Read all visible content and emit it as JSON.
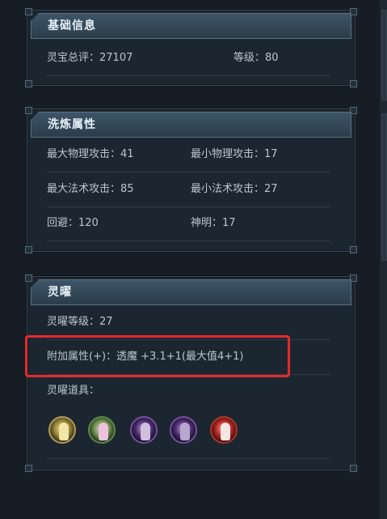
{
  "basic_info": {
    "title": "基础信息",
    "rating_label": "灵宝总评：27107",
    "level_label": "等级：80"
  },
  "refine": {
    "title": "洗炼属性",
    "max_phys": "最大物理攻击：41",
    "min_phys": "最小物理攻击：17",
    "max_magic": "最大法术攻击：85",
    "min_magic": "最小法术攻击：27",
    "dodge": "回避：120",
    "spirit": "神明：17"
  },
  "lingyao": {
    "title": "灵曜",
    "level": "灵曜等级：27",
    "bonus": "附加属性(+)：透魔 +3.1+1(最大值4+1)",
    "items_label": "灵曜道具：",
    "items": [
      {
        "icon": "golden-spirit-icon"
      },
      {
        "icon": "pink-spirit-icon"
      },
      {
        "icon": "purple-warrior-icon"
      },
      {
        "icon": "purple-mage-icon"
      },
      {
        "icon": "red-spirit-icon"
      }
    ]
  },
  "colors": {
    "highlight": "#e52b2b",
    "header": "#3d5567"
  }
}
